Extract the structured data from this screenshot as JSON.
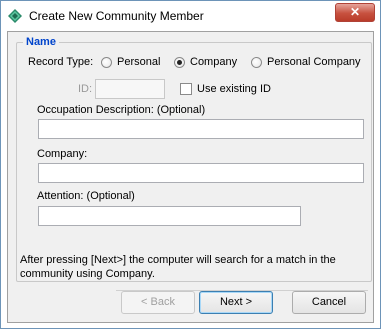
{
  "window": {
    "title": "Create New Community Member",
    "close_symbol": "✕"
  },
  "group": {
    "legend": "Name"
  },
  "record_type": {
    "label": "Record Type:",
    "options": [
      {
        "label": "Personal",
        "checked": false
      },
      {
        "label": "Company",
        "checked": true
      },
      {
        "label": "Personal Company",
        "checked": false
      }
    ]
  },
  "id_field": {
    "label": "ID:",
    "value": "",
    "use_existing_label": "Use existing ID",
    "use_existing_checked": false
  },
  "occupation": {
    "label": "Occupation Description: (Optional)",
    "value": ""
  },
  "company": {
    "label": "Company:",
    "value": ""
  },
  "attention": {
    "label": "Attention:  (Optional)",
    "value": ""
  },
  "info": {
    "text": "After pressing [Next>] the computer will search for a match in the community using Company."
  },
  "buttons": {
    "back": "< Back",
    "next": "Next >",
    "cancel": "Cancel"
  },
  "colors": {
    "legend": "#0044cc",
    "close_button": "#c7513f"
  }
}
